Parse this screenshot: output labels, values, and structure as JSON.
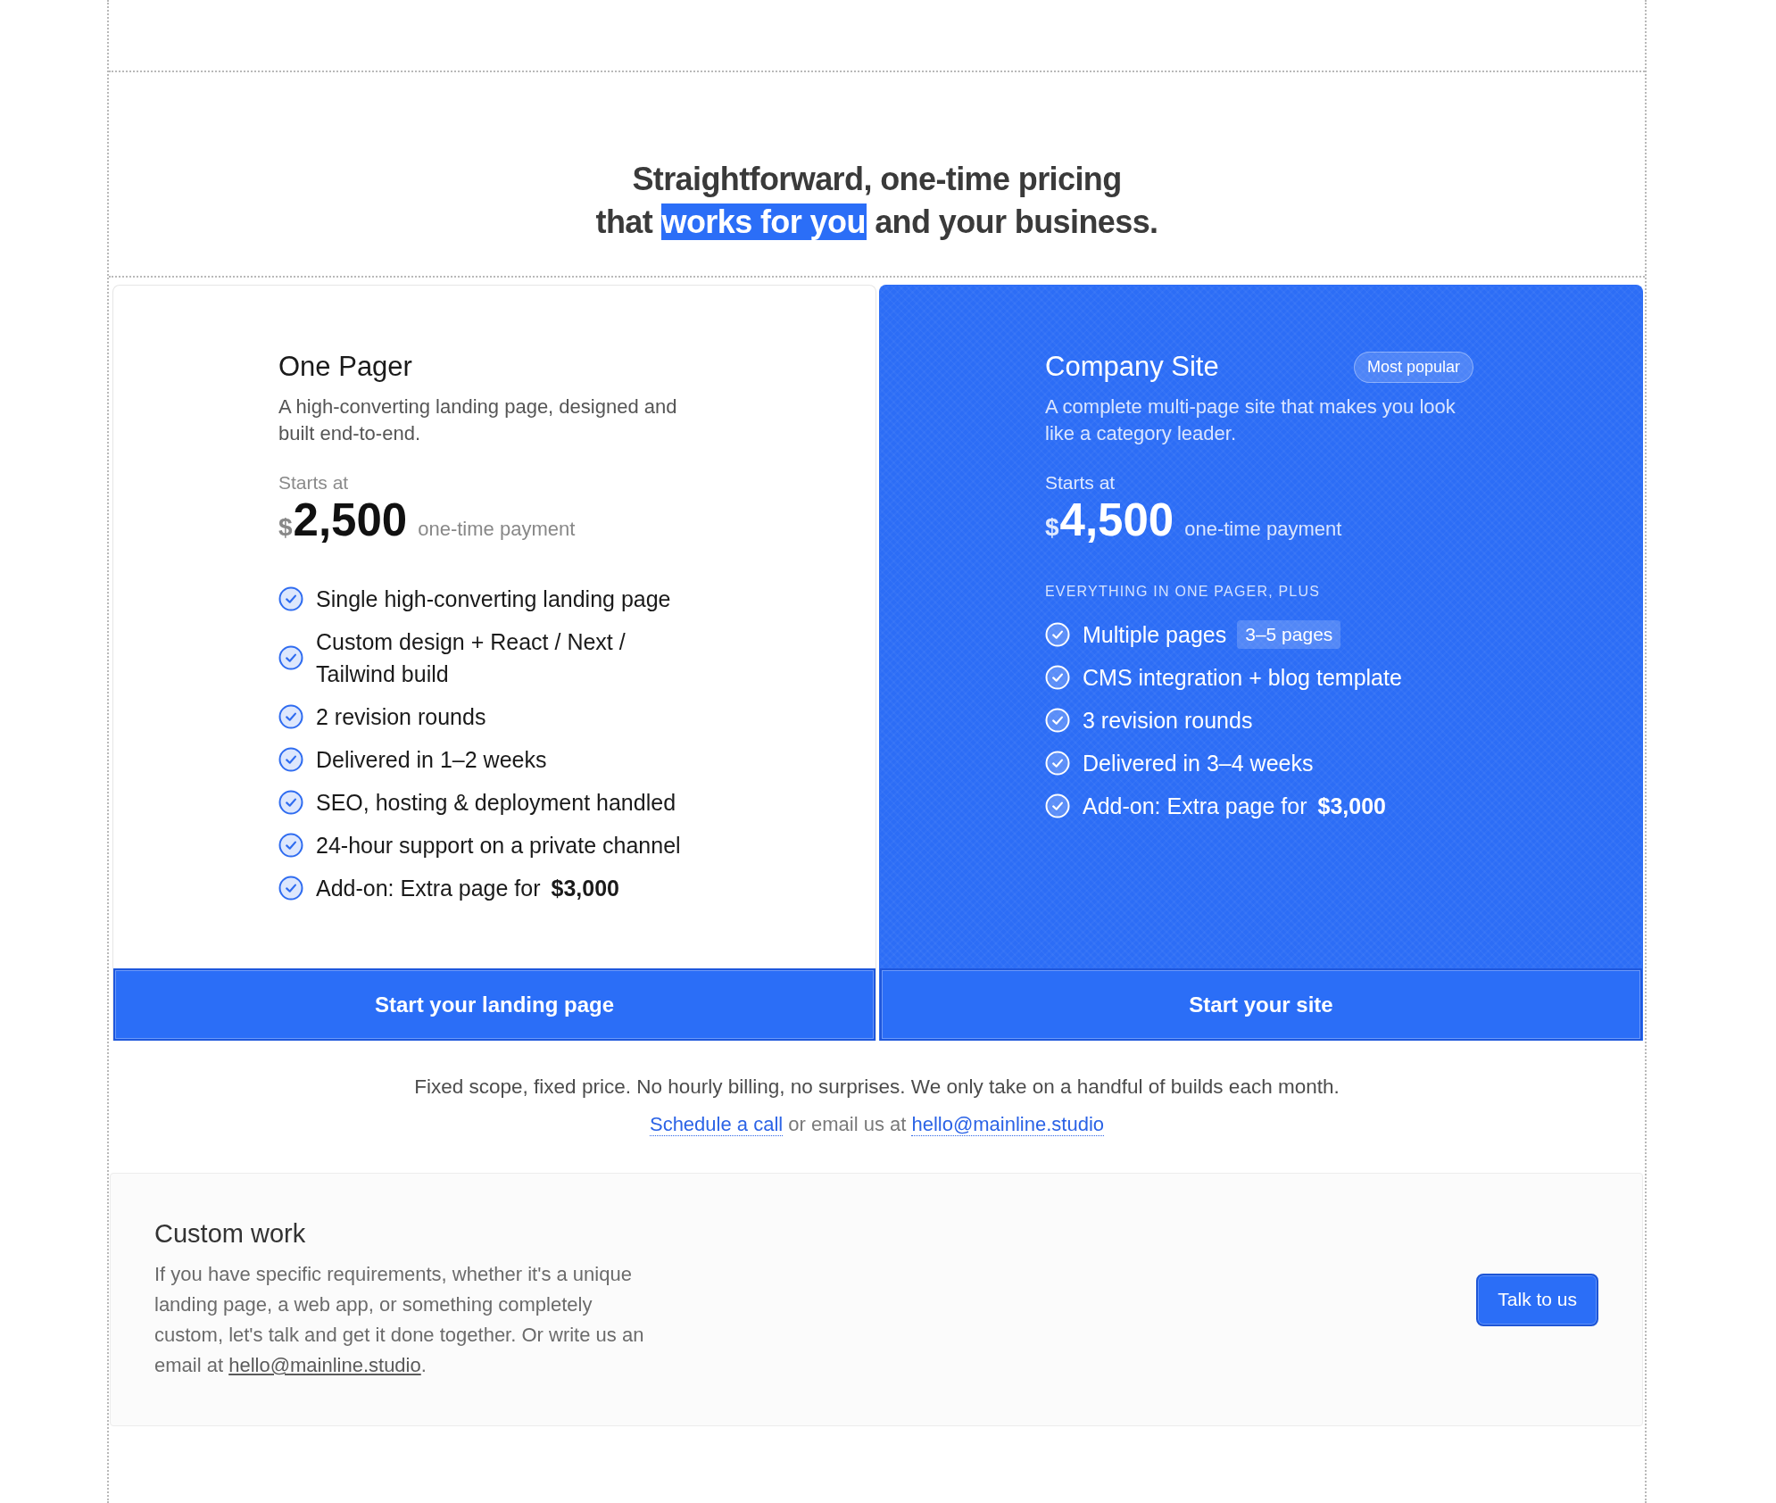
{
  "heading": {
    "line_1": "Straightforward, one-time pricing",
    "line_2": [
      {
        "text": "that",
        "highlighted": false
      },
      {
        "text": "works for you",
        "highlighted": true
      },
      {
        "text": "and your business.",
        "highlighted": false
      }
    ]
  },
  "plans": [
    {
      "name": "One Pager",
      "featured": false,
      "description": "A high-converting landing page, designed and built end-to-end.",
      "price_label": "Starts at",
      "currency": "$",
      "price": "2,500",
      "price_note": "one-time payment",
      "features": [
        {
          "text": "Single high-converting landing page"
        },
        {
          "text": "Custom design + React / Next / Tailwind build"
        },
        {
          "text": "2 revision rounds"
        },
        {
          "text": "Delivered in 1–2 weeks"
        },
        {
          "text": "SEO, hosting & deployment handled"
        },
        {
          "text": "24-hour support on a private channel"
        },
        {
          "text": "Add-on: Extra page for **$3,000**"
        }
      ],
      "button": "Start your landing page"
    },
    {
      "name": "Company Site",
      "featured": true,
      "badge": "Most popular",
      "description": "A complete multi-page site that makes you look like a category leader.",
      "price_label": "Starts at",
      "currency": "$",
      "price": "4,500",
      "price_note": "one-time payment",
      "features_heading": "EVERYTHING IN ONE PAGER, PLUS",
      "features": [
        {
          "text": "Multiple pages",
          "tag": "3–5 pages"
        },
        {
          "text": "CMS integration + blog template"
        },
        {
          "text": "3 revision rounds"
        },
        {
          "text": "Delivered in 3–4 weeks"
        },
        {
          "text": "Add-on: Extra page for **$3,000**"
        }
      ],
      "button": "Start your site"
    }
  ],
  "note": "Fixed scope, fixed price. No hourly billing, no surprises. We only take on a handful of builds each month.",
  "contact": {
    "link_1": "Schedule a call",
    "text": "or email us at",
    "link_2": "hello@mainline.studio"
  },
  "custom_work": {
    "title": "Custom work",
    "text": "If you have specific requirements, whether it's a unique landing page, a web app, or something completely custom, let's talk and get it done together. Or write us an email at",
    "link": "hello@mainline.studio",
    "text_end": ".",
    "button": "Talk to us"
  }
}
